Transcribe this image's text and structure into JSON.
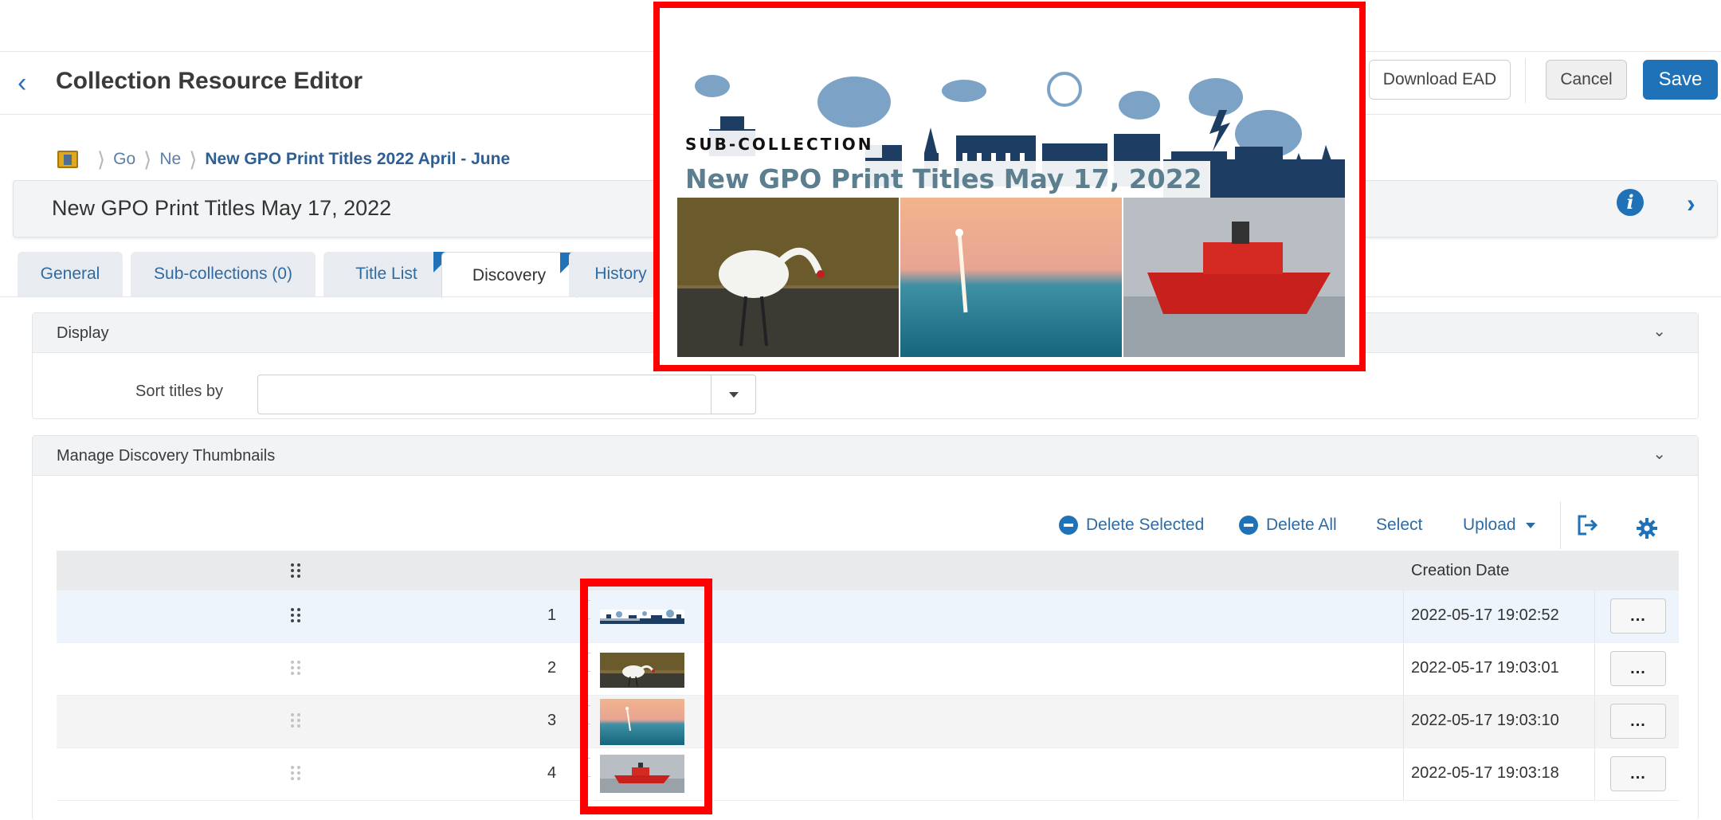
{
  "header": {
    "title": "Collection Resource Editor",
    "download_ead": "Download EAD",
    "cancel": "Cancel",
    "save": "Save"
  },
  "breadcrumb": {
    "items": [
      "Go",
      "Ne"
    ],
    "current": "New GPO Print Titles 2022 April - June"
  },
  "subheader": {
    "title": "New GPO Print Titles May 17, 2022"
  },
  "tabs": [
    {
      "label": "General"
    },
    {
      "label": "Sub-collections (0)"
    },
    {
      "label": "Title List"
    },
    {
      "label": "Discovery"
    },
    {
      "label": "History"
    }
  ],
  "display_panel": {
    "title": "Display",
    "sort_label": "Sort titles by",
    "sort_value": ""
  },
  "thumbnails_panel": {
    "title": "Manage Discovery Thumbnails",
    "toolbar": {
      "delete_selected": "Delete Selected",
      "delete_all": "Delete All",
      "select": "Select",
      "upload": "Upload"
    },
    "columns": {
      "creation_date": "Creation Date"
    },
    "rows": [
      {
        "num": "1",
        "date": "2022-05-17 19:02:52",
        "thumb": "banner"
      },
      {
        "num": "2",
        "date": "2022-05-17 19:03:01",
        "thumb": "crane"
      },
      {
        "num": "3",
        "date": "2022-05-17 19:03:10",
        "thumb": "rocket"
      },
      {
        "num": "4",
        "date": "2022-05-17 19:03:18",
        "thumb": "icebreaker"
      }
    ],
    "more_label": "..."
  },
  "popup": {
    "label": "SUB-COLLECTION",
    "title": "New GPO Print Titles May 17, 2022"
  },
  "colors": {
    "accent": "#1f72b8",
    "highlight": "#ff0000"
  }
}
